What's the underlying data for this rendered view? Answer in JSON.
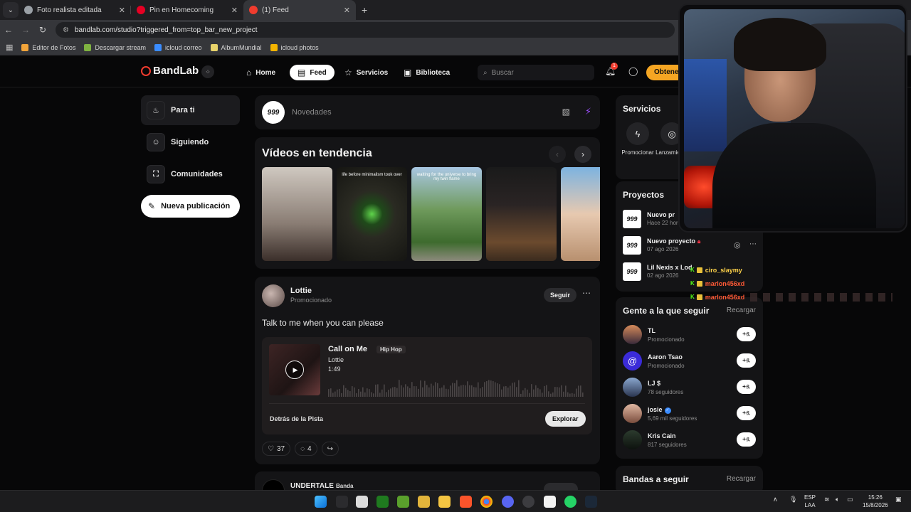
{
  "browser": {
    "tabs": [
      {
        "title": "Foto realista editada",
        "color": "#9aa0a6"
      },
      {
        "title": "Pin en Homecoming",
        "color": "#e60023"
      },
      {
        "title": "(1) Feed",
        "color": "#f03c2e"
      }
    ],
    "url": "bandlab.com/studio?triggered_from=top_bar_new_project",
    "bookmarks": [
      {
        "label": "Editor de Fotos",
        "color": "#f2a43a"
      },
      {
        "label": "Descargar stream",
        "color": "#7fb241"
      },
      {
        "label": "icloud correo",
        "color": "#3a8cff"
      },
      {
        "label": "AlbumMundial",
        "color": "#e8d36b"
      },
      {
        "label": "icloud photos",
        "color": "#f4b400"
      }
    ]
  },
  "nav": {
    "brand": "BandLab",
    "home": "Home",
    "feed": "Feed",
    "services": "Servicios",
    "library": "Biblioteca",
    "search_placeholder": "Buscar",
    "notif_count": "1",
    "cta": "Obtene"
  },
  "sidebar": {
    "items": [
      {
        "label": "Para ti"
      },
      {
        "label": "Siguiendo"
      },
      {
        "label": "Comunidades"
      }
    ],
    "new_post": "Nueva publicación"
  },
  "composer": {
    "avatar": "999",
    "placeholder": "Novedades"
  },
  "trending": {
    "title": "Vídeos en tendencia",
    "videos": [
      {
        "caption": "",
        "bg": "linear-gradient(180deg,#cfc8c0,#8a7d74 60%,#3b2f2a)"
      },
      {
        "caption": "life before minimalism took over",
        "bg": "radial-gradient(circle at 50% 50%,#5fd44b 0,#1f4a1a 18%,#2a2a22 40%,#151512 100%)"
      },
      {
        "caption": "waiting for the universe to bring my twin flame",
        "bg": "linear-gradient(180deg,#a9c7e3 0%,#6f9a5c 45%,#3e6b2e 80%,#8c8a7c 100%)"
      },
      {
        "caption": "",
        "bg": "linear-gradient(180deg,#1a1a1a,#2a2424 40%,#6b4a2e 80%,#3b2b1e)"
      },
      {
        "caption": "",
        "bg": "linear-gradient(180deg,#7db3e0,#e7c9b0 50%,#b8906f)"
      }
    ]
  },
  "post": {
    "author": "Lottie",
    "subtitle": "Promocionado",
    "follow": "Seguir",
    "text": "Talk to me when you can please",
    "track_title": "Call on Me",
    "genre": "Hip Hop",
    "artist": "Lottie",
    "duration": "1:49",
    "behind": "Detrás de la Pista",
    "explore": "Explorar",
    "likes": "37",
    "comments": "4"
  },
  "post2": {
    "author": "UNDERTALE",
    "tag": "Banda"
  },
  "services_panel": {
    "title": "Servicios",
    "items": [
      {
        "label": "Promocionar"
      },
      {
        "label": "Lanzamiento"
      }
    ]
  },
  "projects": {
    "title": "Proyectos",
    "items": [
      {
        "title": "Nuevo pr",
        "date": "Hace 22 hor"
      },
      {
        "title": "Nuevo proyecto",
        "date": "07 ago 2026"
      },
      {
        "title": "Lil Nexis x Lod",
        "date": "02 ago 2026"
      }
    ]
  },
  "people": {
    "title": "Gente a la que seguir",
    "reload": "Recargar",
    "items": [
      {
        "name": "TL",
        "sub": "Promocionado",
        "bg": "linear-gradient(180deg,#d58a5a,#3a2a3a)"
      },
      {
        "name": "Aaron Tsao",
        "sub": "Promocionado",
        "bg": "#3b2bd8"
      },
      {
        "name": "LJ $",
        "sub": "78 seguidores",
        "bg": "linear-gradient(180deg,#8aa7cf,#2a3550)"
      },
      {
        "name": "josie",
        "sub": "5,69 mil seguidores",
        "bg": "linear-gradient(180deg,#e0b7a2,#7a4d3d)"
      },
      {
        "name": "Kris Cain",
        "sub": "817 seguidores",
        "bg": "linear-gradient(180deg,#2c3b2e,#0d120e)"
      }
    ],
    "follow_label": "+ዷ"
  },
  "bands": {
    "title": "Bandas a seguir",
    "reload": "Recargar"
  },
  "chat": [
    {
      "user": "ciro_slaymy"
    },
    {
      "user": "marlon456xd"
    },
    {
      "user": "marlon456xd"
    }
  ],
  "taskbar": {
    "lang1": "ESP",
    "lang2": "LAA",
    "time": "15:26",
    "date": "15/8/2026"
  }
}
